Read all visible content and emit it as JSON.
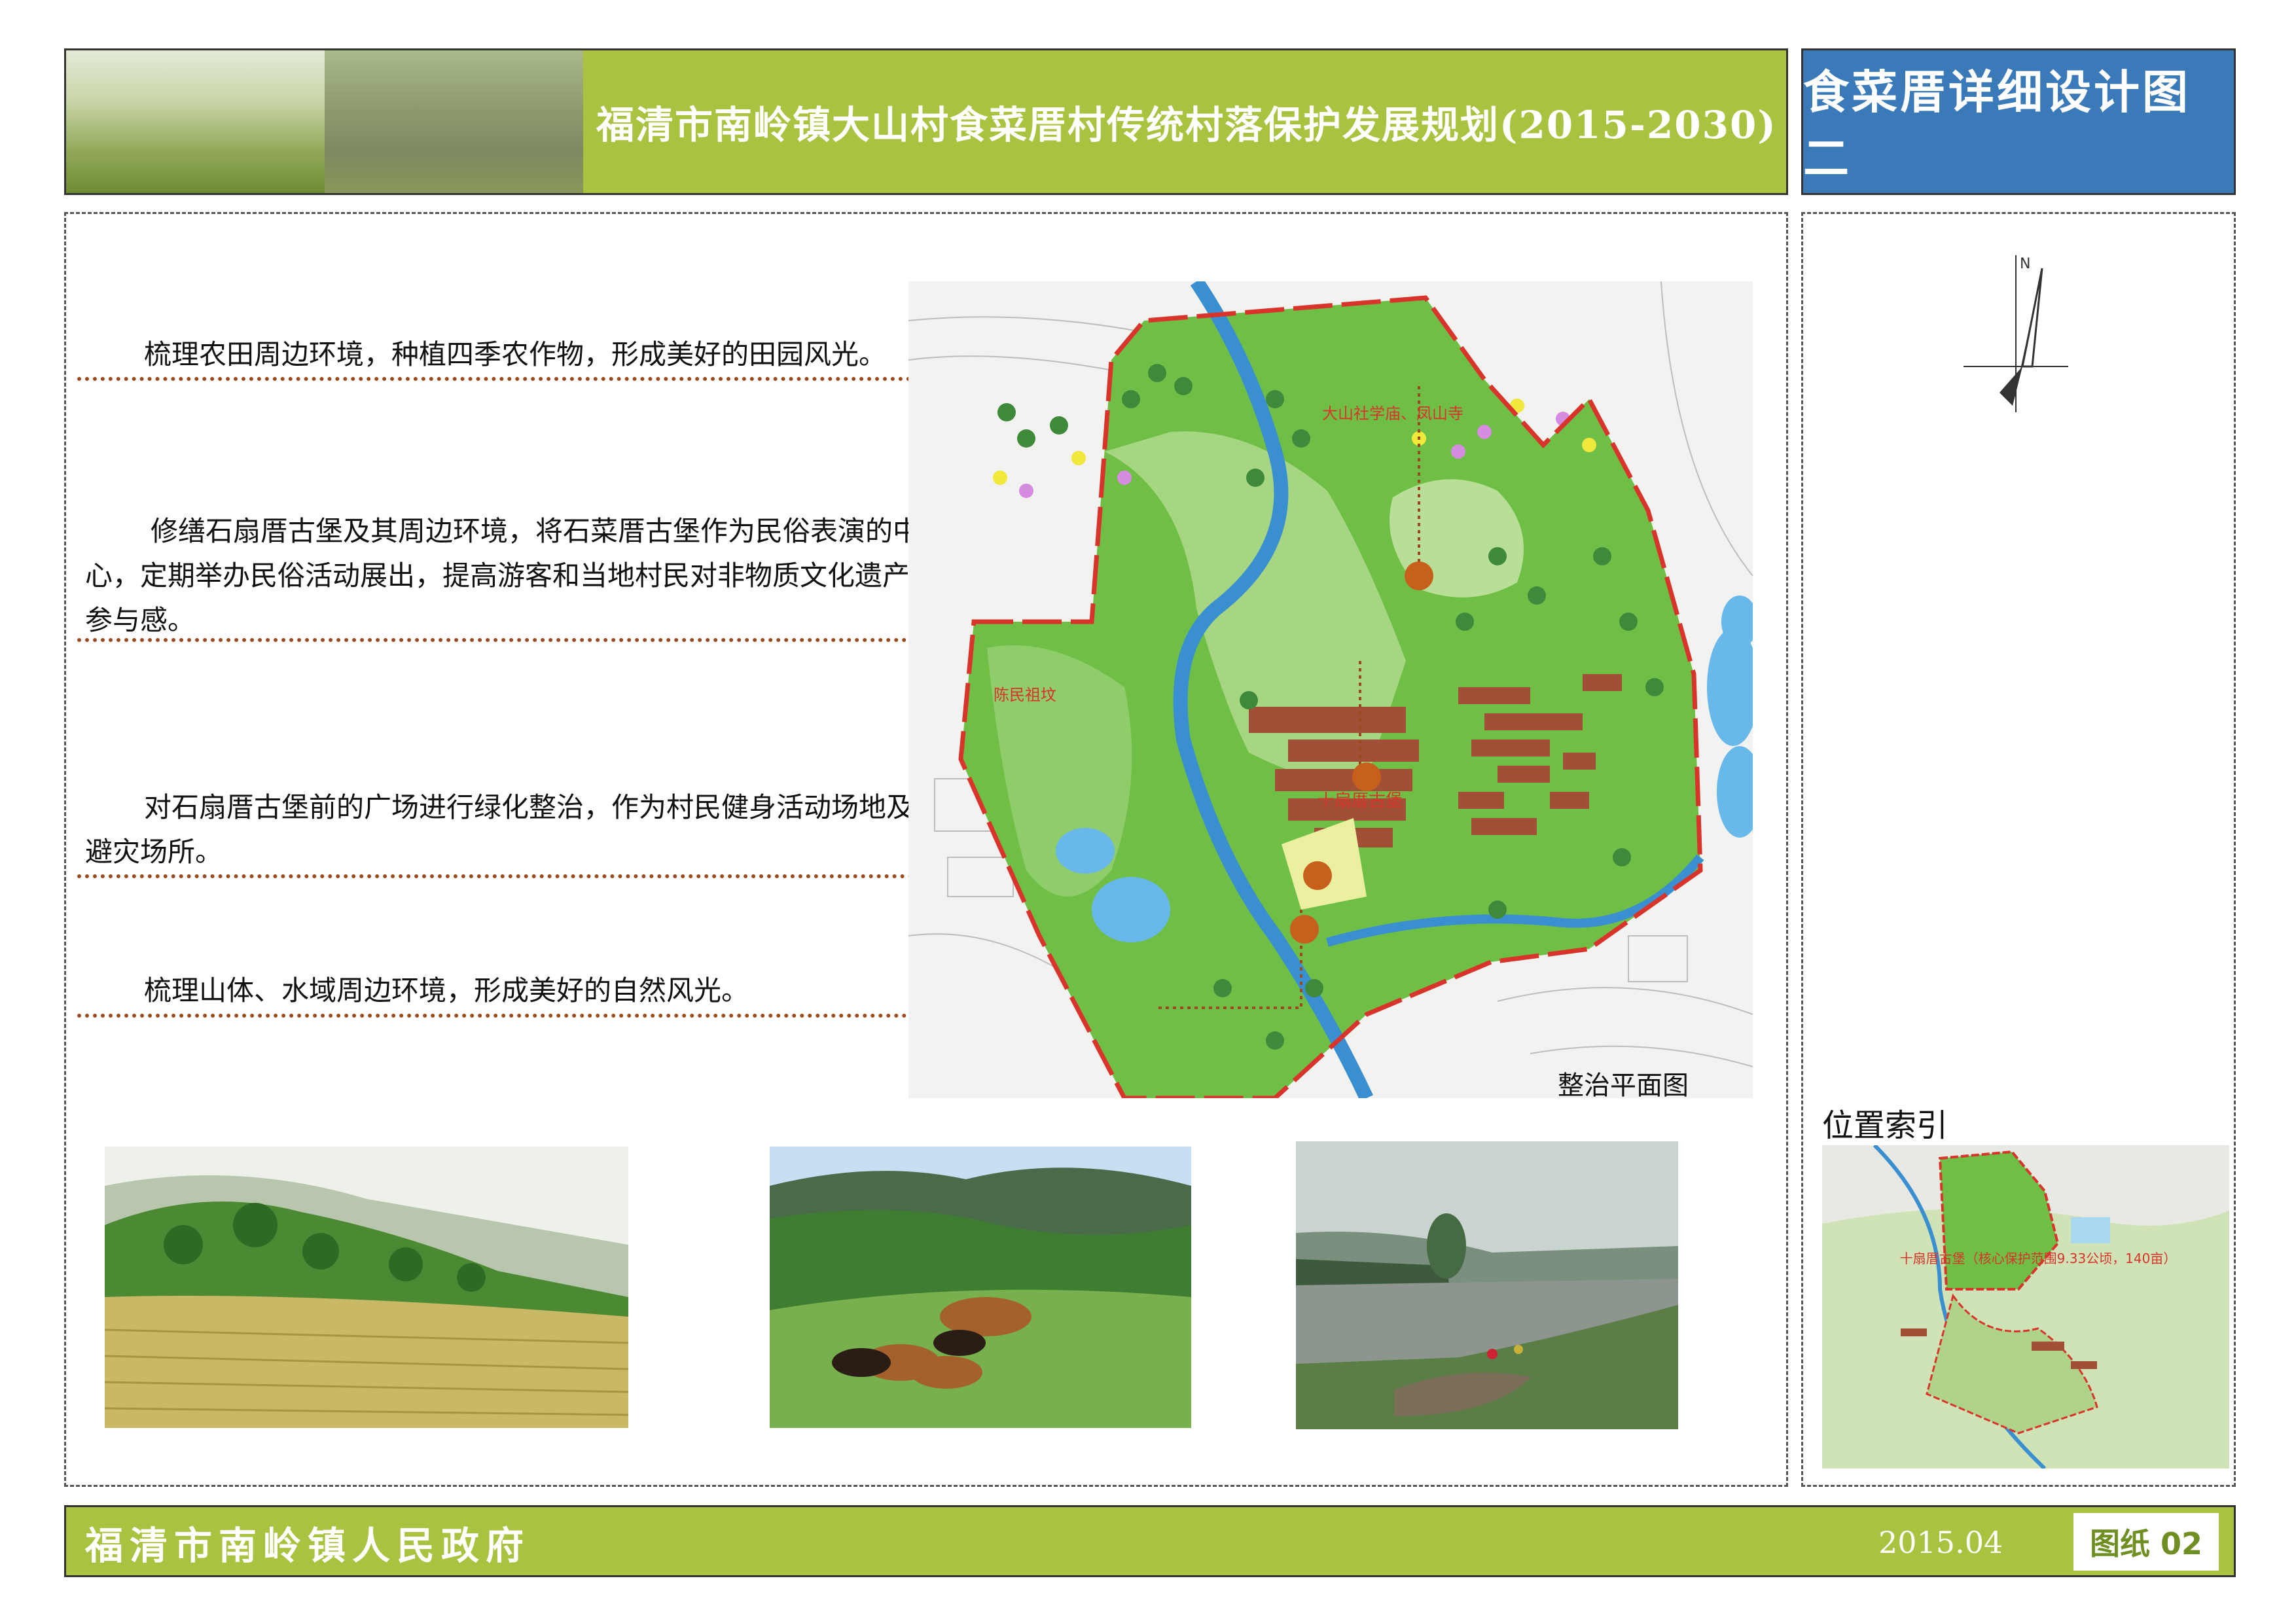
{
  "header": {
    "title": "福清市南岭镇大山村食菜厝村传统村落保护发展规划(2015-2030)",
    "sheet_title": "食菜厝详细设计图二"
  },
  "paragraphs": [
    "梳理农田周边环境，种植四季农作物，形成美好的田园风光。",
    "修缮石扇厝古堡及其周边环境，将石菜厝古堡作为民俗表演的中心，定期举办民俗活动展出，提高游客和当地村民对非物质文化遗产的参与感。",
    "对石扇厝古堡前的广场进行绿化整治，作为村民健身活动场地及应急避灾场所。",
    "梳理山体、水域周边环境，形成美好的自然风光。"
  ],
  "map": {
    "caption": "整治平面图",
    "labels": {
      "temple": "大山社学庙、凤山寺",
      "tomb": "陈民祖坟",
      "fort": "十扇厝古堡"
    }
  },
  "location": {
    "title": "位置索引",
    "label": "十扇厝古堡（核心保护范围9.33公顷，140亩）"
  },
  "compass": {
    "letter": "N"
  },
  "footer": {
    "org": "福清市南岭镇人民政府",
    "date": "2015.04",
    "sheet_no": "图纸 02"
  },
  "colors": {
    "header_green": "#a9c23f",
    "sheet_blue": "#3b7ab8",
    "dotted_line": "#9b4a1e",
    "boundary_red": "#d9342b"
  }
}
